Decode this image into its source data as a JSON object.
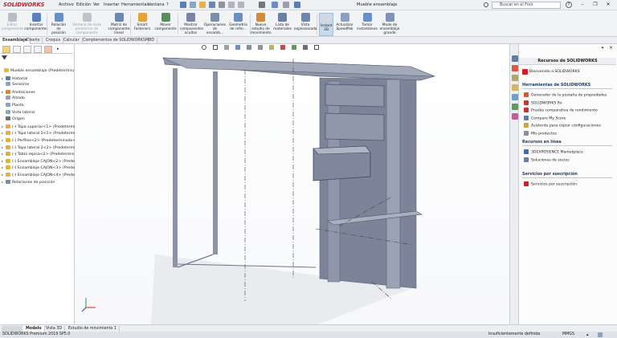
{
  "app": {
    "logo_text": "SOLIDWORKS",
    "document_title": "Mueble ensamblaje",
    "search_placeholder": "Buscar en el Foro"
  },
  "menu": [
    "Archivo",
    "Edición",
    "Ver",
    "Insertar",
    "Herramientas",
    "Ventana",
    "?"
  ],
  "commands": [
    {
      "label": "Editar\ncomponente",
      "disabled": true
    },
    {
      "label": "Insertar\ncomponentes",
      "disabled": false
    },
    {
      "label": "Relación\nde\nposición",
      "disabled": false
    },
    {
      "label": "Ventana de vista\npreliminar de\ncomponente",
      "disabled": true
    },
    {
      "label": "Matriz de\ncomponente lineal",
      "disabled": false
    },
    {
      "label": "Smart\nFasteners",
      "disabled": false
    },
    {
      "label": "Mover\ncomponente",
      "disabled": false
    },
    {
      "label": "Mostrar\ncomponentes\nocultos",
      "disabled": false
    },
    {
      "label": "Operaciones\nde ensamb...",
      "disabled": false
    },
    {
      "label": "Geometría\nde refer...",
      "disabled": false
    },
    {
      "label": "Nuevo\nestudio de\nmovimiento",
      "disabled": false
    },
    {
      "label": "Lista de\nmateriales",
      "disabled": false
    },
    {
      "label": "Vista\nexplosionada",
      "disabled": false
    },
    {
      "label": "Instant\n3D",
      "disabled": false,
      "active": true
    },
    {
      "label": "Actualizar\nSpeedPak",
      "disabled": false
    },
    {
      "label": "Tomar\ninstantánea",
      "disabled": false
    },
    {
      "label": "Modo de\nensamblaje\ngrande",
      "disabled": false
    }
  ],
  "tabs": [
    "Ensamblaje",
    "Diseño",
    "Croquis",
    "Calcular",
    "Complementos de SOLIDWORKS",
    "MBD"
  ],
  "tree": [
    {
      "label": "Mueble ensamblaje  (Predeterminado",
      "arrow": "",
      "indent": 0
    },
    {
      "label": "Historial",
      "arrow": "▸",
      "indent": 1
    },
    {
      "label": "Sensores",
      "arrow": "",
      "indent": 1
    },
    {
      "label": "Anotaciones",
      "arrow": "▸",
      "indent": 1
    },
    {
      "label": "Alzado",
      "arrow": "",
      "indent": 1
    },
    {
      "label": "Planta",
      "arrow": "",
      "indent": 1
    },
    {
      "label": "Vista lateral",
      "arrow": "",
      "indent": 1
    },
    {
      "label": "Origen",
      "arrow": "",
      "indent": 1
    },
    {
      "label": "(-) Tapa superior<1> (Predetermi",
      "arrow": "▸",
      "indent": 1
    },
    {
      "label": "(-) Tapa lateral  2<1> (Predetermin",
      "arrow": "▸",
      "indent": 1
    },
    {
      "label": "(-) Perfiles<2> (Predeterminado<",
      "arrow": "▸",
      "indent": 1
    },
    {
      "label": "(-) Tapa lateral  2<2> (Predetermin",
      "arrow": "▸",
      "indent": 1
    },
    {
      "label": "(-) Tabla repisa<2> (Predetermina",
      "arrow": "▸",
      "indent": 1
    },
    {
      "label": "(-) Ensamblaje CAJON<2> (Predet",
      "arrow": "▸",
      "indent": 1
    },
    {
      "label": "(-) Ensamblaje CAJON<3> (Prede",
      "arrow": "▸",
      "indent": 1
    },
    {
      "label": "(-) Ensamblaje CAJON<4> (Prede",
      "arrow": "▸",
      "indent": 1
    },
    {
      "label": "Relaciones de posición",
      "arrow": "▸",
      "indent": 1
    }
  ],
  "taskpane": {
    "title": "Recursos de SOLIDWORKS",
    "welcome": "Bienvenido a SOLIDWORKS",
    "tools_header": "Herramientas de SOLIDWORKS",
    "tools": [
      "Generador de la pestaña de propiedades",
      "SOLIDWORKS Rx",
      "Prueba comparativa de rendimiento",
      "Compare My Score",
      "Asistente para copiar configuraciones",
      "Mis productos"
    ],
    "online_header": "Recursos en línea",
    "online": [
      "3DEXPERIENCE Marketplace",
      "Soluciones de socios"
    ],
    "subscription_header": "Servicios por suscripción",
    "subscription": [
      "Servicios por suscripción"
    ]
  },
  "bottom_tabs": [
    "Modelo",
    "Vista 3D",
    "Estudio de movimiento 1"
  ],
  "status": {
    "left": "SOLIDWORKS Premium 2019 SP5.0",
    "middle": "Insuficientemente definida",
    "units": "MMGS"
  },
  "colors": {
    "brand_red": "#d11f26",
    "panel_face": "#8c95a8",
    "panel_dark": "#6a7388"
  }
}
